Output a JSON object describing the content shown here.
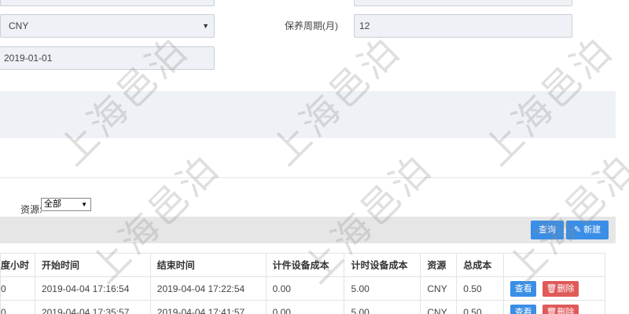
{
  "form": {
    "currency_value": "CNY",
    "maintenance_label": "保养周期(月)",
    "maintenance_value": "12",
    "date_value": "2019-01-01"
  },
  "filter": {
    "source_label": "资源:",
    "source_value": "全部"
  },
  "toolbar": {
    "query_label": "查询",
    "new_label": "新建"
  },
  "table": {
    "headers": [
      "度小时",
      "开始时间",
      "结束时间",
      "计件设备成本",
      "计时设备成本",
      "资源",
      "总成本",
      ""
    ],
    "rows": [
      [
        "0",
        "2019-04-04 17:16:54",
        "2019-04-04 17:22:54",
        "0.00",
        "5.00",
        "CNY",
        "0.50"
      ],
      [
        "0",
        "2019-04-04 17:35:57",
        "2019-04-04 17:41:57",
        "0.00",
        "5.00",
        "CNY",
        "0.50"
      ]
    ],
    "view_label": "查看",
    "delete_label": "删除"
  },
  "watermark": {
    "text": "上海邑泊"
  }
}
